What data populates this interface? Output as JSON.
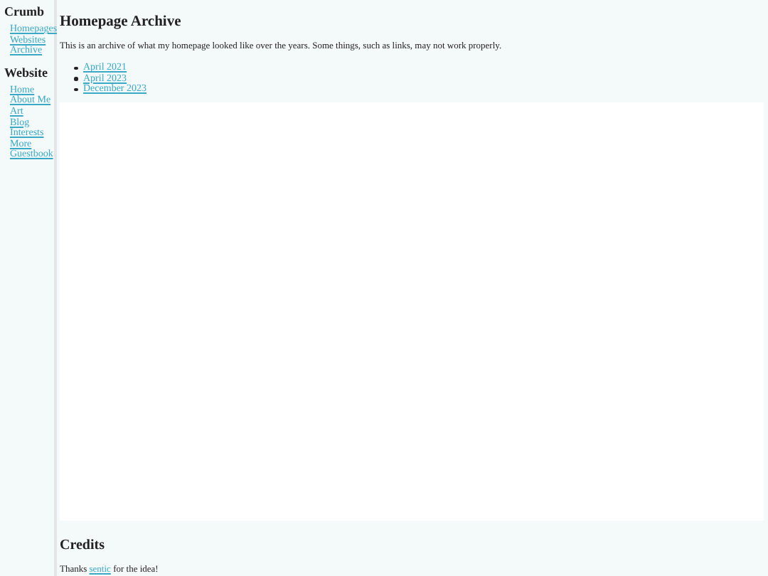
{
  "sidebar": {
    "sections": [
      {
        "heading": "Crumb",
        "links": [
          "Homepages",
          "Websites",
          "Archive"
        ]
      },
      {
        "heading": "Website",
        "links": [
          "Home",
          "About Me",
          "Art",
          "Blog",
          "Interests",
          "More",
          "Guestbook"
        ]
      }
    ]
  },
  "main": {
    "title": "Homepage Archive",
    "intro": "This is an archive of what my homepage looked like over the years. Some things, such as links, may not work properly.",
    "archive_links": [
      "April 2021",
      "April 2023",
      "December 2023"
    ],
    "credits": {
      "heading": "Credits",
      "before": "Thanks ",
      "link": "sentic",
      "after": " for the idea!"
    }
  }
}
